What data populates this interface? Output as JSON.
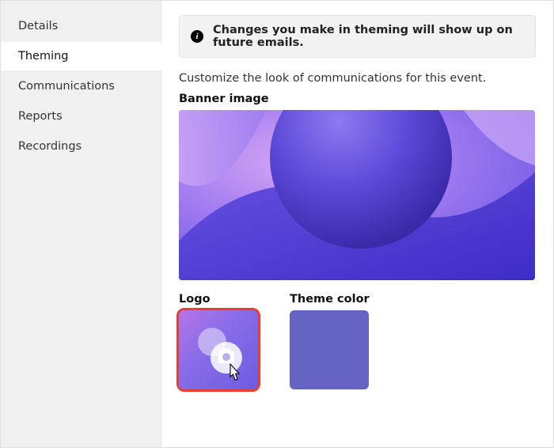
{
  "sidebar": {
    "items": [
      {
        "label": "Details"
      },
      {
        "label": "Theming"
      },
      {
        "label": "Communications"
      },
      {
        "label": "Reports"
      },
      {
        "label": "Recordings"
      }
    ],
    "active_index": 1
  },
  "info": {
    "icon_glyph": "i",
    "text": "Changes you make in theming will show up on future emails."
  },
  "description": "Customize the look of communications for this event.",
  "sections": {
    "banner_label": "Banner image",
    "logo_label": "Logo",
    "theme_color_label": "Theme color"
  },
  "theme_color": "#6664c2",
  "highlight_color": "#e93f33"
}
